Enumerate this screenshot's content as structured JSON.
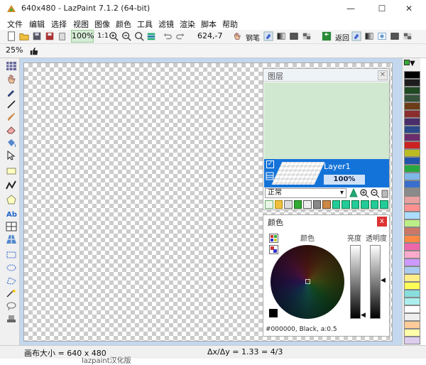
{
  "window": {
    "title": "640x480 - LazPaint 7.1.2 (64-bit)",
    "minimize": "—",
    "maximize": "☐",
    "close": "✕"
  },
  "menu": [
    "文件",
    "编辑",
    "选择",
    "视图",
    "图像",
    "颜色",
    "工具",
    "滤镜",
    "渲染",
    "脚本",
    "帮助"
  ],
  "toolbar": {
    "zoom_value": "100%",
    "zoom_ratio": "1:1",
    "coord": "624,-7",
    "pen_label": "钢笔",
    "return_label": "返回"
  },
  "toolbar2": {
    "zoom_value": "25%"
  },
  "layers_panel": {
    "title": "图层",
    "layer_name": "Layer1",
    "opacity": "100%",
    "blend_mode": "正常"
  },
  "color_panel": {
    "title": "颜色",
    "color_label": "颜色",
    "brightness_label": "亮度",
    "opacity_label": "透明度",
    "color_value": "#000000, Black, a:0.5"
  },
  "status": {
    "canvas_size": "画布大小 = 640 x 480",
    "ratio": "Δx/Δy = 1.33 = 4/3",
    "overflow_text": "lazpaint汉化版"
  },
  "palette_colors": [
    "#000000",
    "#1d1d1d",
    "#214a23",
    "#35523a",
    "#6b3c16",
    "#8b2d2d",
    "#4a2d6b",
    "#2d4a8b",
    "#6b2d6b",
    "#cc2222",
    "#bbbb22",
    "#2255aa",
    "#2aa840",
    "#7fb7e6",
    "#3a6ecc",
    "#8a8a8a",
    "#e8a0a0",
    "#ff9090",
    "#aaddff",
    "#bbee88",
    "#cc7766",
    "#ff8844",
    "#ee66aa",
    "#ffaacc",
    "#cc99ff",
    "#aaccee",
    "#ffee88",
    "#ffff55",
    "#88dddd",
    "#aaeeee",
    "#ffffff",
    "#eeeeee",
    "#ffcc99",
    "#ffffaa",
    "#ddccee"
  ],
  "colors": {
    "accent": "#1473d8",
    "workspace": "#c3d8ee",
    "layer_bg": "#d0e8d0"
  }
}
